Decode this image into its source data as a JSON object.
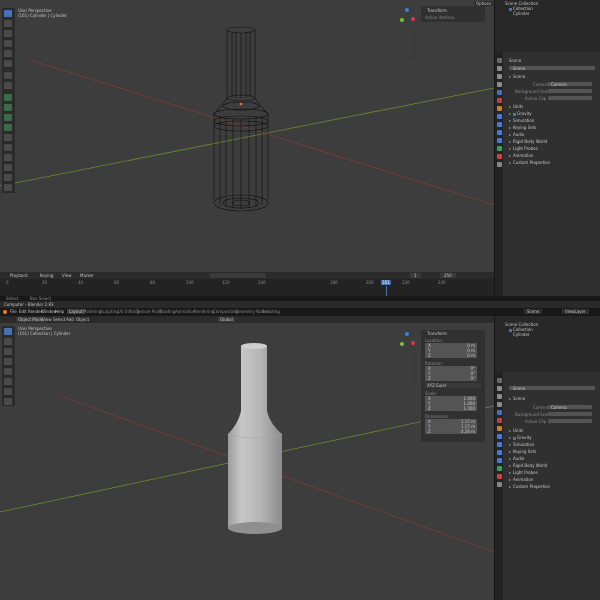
{
  "top": {
    "viewport_info": {
      "mode": "User Perspective",
      "object": "(161) Cylinder | Cylinder"
    },
    "header_options": "Options",
    "npanel": {
      "title": "Transform",
      "subtitle": "Active Vertices"
    },
    "outliner": {
      "title": "Scene Collection",
      "collection": "Collection",
      "object": "Cylinder"
    },
    "properties": {
      "scene": "Scene",
      "scene_field": "Scene",
      "section": "Scene",
      "camera_label": "Camera",
      "camera_value": "Camera",
      "bg_label": "Background Scene",
      "active_clip_label": "Active Clip",
      "panels": [
        "Units",
        "Gravity",
        "Simulation",
        "Keying Sets",
        "Audio",
        "Rigid Body World",
        "Light Probes",
        "Animation",
        "Custom Properties"
      ]
    },
    "timeline": {
      "menu": [
        "Playback",
        "Keying",
        "View",
        "Marker"
      ],
      "frame_start": "1",
      "frame_end": "250",
      "current_frame": "161",
      "ticks": [
        "0",
        "10",
        "20",
        "30",
        "40",
        "50",
        "60",
        "70",
        "80",
        "90",
        "100",
        "110",
        "120",
        "130",
        "140",
        "150",
        "160",
        "170",
        "180",
        "190",
        "200",
        "210",
        "220",
        "230",
        "240",
        "250"
      ]
    },
    "status": [
      "Select",
      "Box Select",
      "Rotate View"
    ]
  },
  "bottom": {
    "title": "Computer - Blender 2.83",
    "menu": [
      "File",
      "Edit",
      "Render",
      "Window",
      "Help"
    ],
    "workspaces": [
      "Layout",
      "Modeling",
      "Sculpting",
      "UV Editing",
      "Texture Paint",
      "Shading",
      "Animation",
      "Rendering",
      "Compositing",
      "Geometry Nodes",
      "Scripting"
    ],
    "viewport_header": [
      "Object Mode",
      "View",
      "Select",
      "Add",
      "Object"
    ],
    "transform_orient": "Global",
    "scene_name": "Scene",
    "view_layer": "ViewLayer",
    "viewport_info": {
      "mode": "User Perspective",
      "object": "(161) Collection | Cylinder"
    },
    "npanel": {
      "title": "Transform",
      "location": "Location:",
      "loc": [
        [
          "X",
          "0 m"
        ],
        [
          "Y",
          "0 m"
        ],
        [
          "Z",
          "0 m"
        ]
      ],
      "rotation": "Rotation:",
      "rot": [
        [
          "X",
          "0°"
        ],
        [
          "Y",
          "0°"
        ],
        [
          "Z",
          "0°"
        ]
      ],
      "rotation_mode": "XYZ Euler",
      "scale": "Scale:",
      "scl": [
        [
          "X",
          "1.000"
        ],
        [
          "Y",
          "1.000"
        ],
        [
          "Z",
          "1.000"
        ]
      ],
      "dimensions": "Dimensions:",
      "dim": [
        [
          "X",
          "1.17 m"
        ],
        [
          "Y",
          "1.17 m"
        ],
        [
          "Z",
          "4.28 m"
        ]
      ]
    },
    "outliner": {
      "title": "Scene Collection",
      "collection": "Collection",
      "object": "Cylinder"
    },
    "properties": {
      "scene_field": "Scene",
      "section": "Scene",
      "camera_label": "Camera",
      "camera_value": "Camera",
      "bg_label": "Background Scene",
      "active_clip_label": "Active Clip",
      "panels": [
        "Units",
        "Gravity",
        "Simulation",
        "Keying Sets",
        "Audio",
        "Rigid Body World",
        "Light Probes",
        "Animation",
        "Custom Properties"
      ]
    }
  },
  "colors": {
    "accent": "#4772b3",
    "viewport": "#3d3d3d",
    "x_axis": "#8e3a3a",
    "y_axis": "#6b8b2a",
    "gizmo_x": "#e0344b",
    "gizmo_y": "#7bbb2c",
    "gizmo_z": "#3b7ddb"
  }
}
